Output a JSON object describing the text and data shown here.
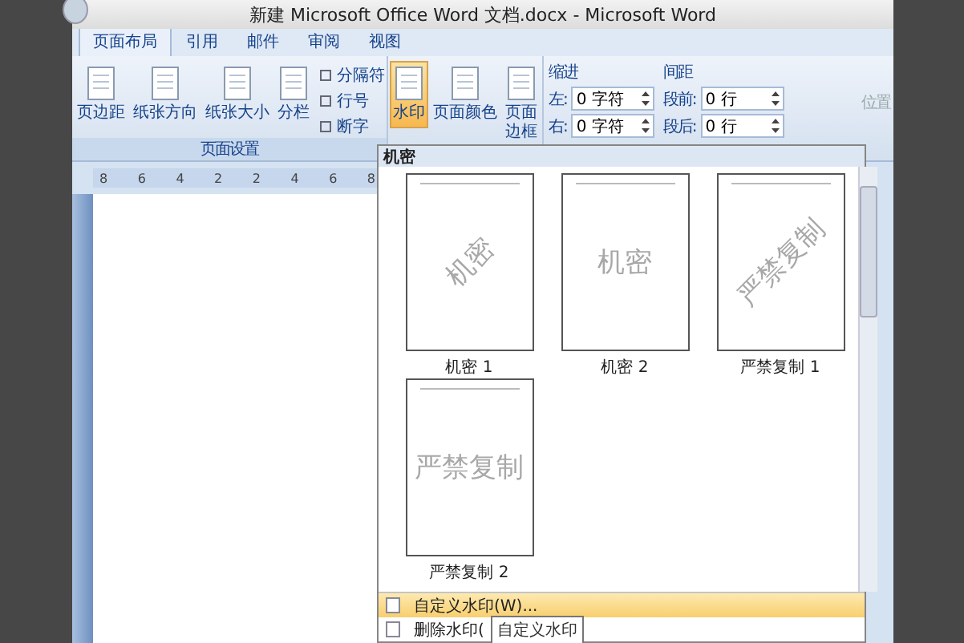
{
  "title_bar": {
    "title": "新建 Microsoft Office Word 文档.docx - Microsoft Word"
  },
  "tabs": [
    {
      "label": "页面布局",
      "selected": true
    },
    {
      "label": "引用",
      "selected": false
    },
    {
      "label": "邮件",
      "selected": false
    },
    {
      "label": "审阅",
      "selected": false
    },
    {
      "label": "视图",
      "selected": false
    }
  ],
  "page_setup": {
    "large_buttons": [
      {
        "label": "页边距"
      },
      {
        "label": "纸张方向"
      },
      {
        "label": "纸张大小"
      },
      {
        "label": "分栏"
      }
    ],
    "small_buttons": [
      {
        "label": "分隔符"
      },
      {
        "label": "行号"
      },
      {
        "label": "断字"
      }
    ],
    "group_label": "页面设置"
  },
  "background": {
    "buttons": [
      {
        "label": "水印",
        "selected": true
      },
      {
        "label": "页面颜色",
        "selected": false
      },
      {
        "label": "页面边框",
        "selected": false
      }
    ]
  },
  "indent": {
    "heading": "缩进",
    "fields": [
      {
        "label": "左:",
        "value": "0 字符"
      },
      {
        "label": "右:",
        "value": "0 字符"
      }
    ]
  },
  "spacing": {
    "heading": "间距",
    "fields": [
      {
        "label": "段前:",
        "value": "0 行"
      },
      {
        "label": "段后:",
        "value": "0 行"
      }
    ]
  },
  "position": {
    "label": "位置"
  },
  "ruler": {
    "labels": [
      "8",
      "6",
      "4",
      "2",
      "2",
      "4",
      "6",
      "8"
    ]
  },
  "watermark_menu": {
    "section": "机密",
    "items": [
      {
        "label": "机密 1",
        "watermark": "机密",
        "kind": "diagonal"
      },
      {
        "label": "机密 2",
        "watermark": "机密",
        "kind": "horizontal"
      },
      {
        "label": "严禁复制 1",
        "watermark": "严禁复制",
        "kind": "diagonal"
      },
      {
        "label": "严禁复制 2",
        "watermark": "严禁复制",
        "kind": "horizontal"
      }
    ],
    "commands": [
      {
        "label": "自定义水印(W)...",
        "selected": true
      },
      {
        "label": "删除水印(",
        "selected": false
      }
    ]
  },
  "tooltip": "自定义水印"
}
